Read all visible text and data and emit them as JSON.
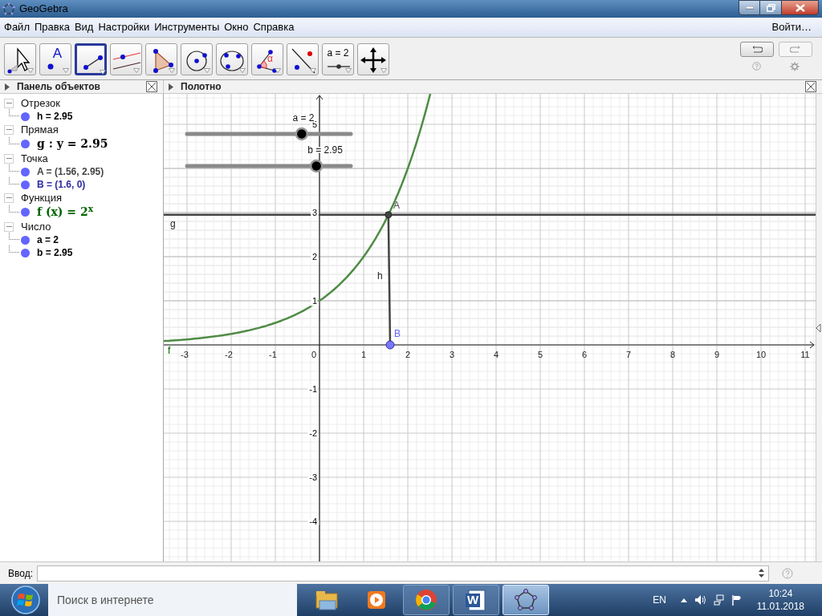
{
  "window": {
    "title": "GeoGebra"
  },
  "menu": [
    "Файл",
    "Правка",
    "Вид",
    "Настройки",
    "Инструменты",
    "Окно",
    "Справка"
  ],
  "login": "Войти…",
  "tools": [
    {
      "selected": false
    },
    {
      "selected": false,
      "label": "A"
    },
    {
      "selected": true
    },
    {
      "selected": false
    },
    {
      "selected": false
    },
    {
      "selected": false
    },
    {
      "selected": false
    },
    {
      "selected": false,
      "label": "α"
    },
    {
      "selected": false
    },
    {
      "selected": false,
      "label": "a = 2"
    },
    {
      "selected": false
    }
  ],
  "algebra_panel": {
    "title": "Панель объектов",
    "groups": [
      {
        "title": "Отрезок",
        "expanded": true,
        "children": [
          {
            "text": "h = 2.95",
            "kind": "plain",
            "color": "#000000"
          }
        ]
      },
      {
        "title": "Прямая",
        "expanded": true,
        "children": [
          {
            "text": "g : y = 2.95",
            "kind": "formula",
            "color": "#000000"
          }
        ]
      },
      {
        "title": "Точка",
        "expanded": true,
        "children": [
          {
            "text": "A = (1.56, 2.95)",
            "kind": "plain",
            "color": "#444444"
          },
          {
            "text": "B = (1.6, 0)",
            "kind": "plain",
            "color": "#2c2ca0"
          }
        ]
      },
      {
        "title": "Функция",
        "expanded": true,
        "children": [
          {
            "text": "f (x) = 2$^{x}$",
            "kind": "formula",
            "color": "#006400"
          }
        ]
      },
      {
        "title": "Число",
        "expanded": true,
        "children": [
          {
            "text": "a = 2",
            "kind": "plain",
            "color": "#000000"
          },
          {
            "text": "b = 2.95",
            "kind": "plain",
            "color": "#000000"
          }
        ]
      }
    ]
  },
  "graphics": {
    "title": "Полотно",
    "x_tick_labels": [
      "-3",
      "-2",
      "-1",
      "1",
      "2",
      "3",
      "4",
      "5",
      "6",
      "7",
      "8",
      "9",
      "10",
      "11"
    ],
    "y_tick_labels": [
      "5",
      "3",
      "2",
      "1",
      "-1",
      "-2",
      "-3",
      "-4"
    ],
    "origin_label": "0",
    "sliders": [
      {
        "label": "a = 2",
        "level": 0.7
      },
      {
        "label": "b = 2.95",
        "level": 0.79
      }
    ],
    "object_labels": [
      {
        "text": "g"
      },
      {
        "text": "h"
      },
      {
        "text": "A"
      },
      {
        "text": "B"
      },
      {
        "text": "f"
      }
    ]
  },
  "input_bar": {
    "label": "Ввод:"
  },
  "taskbar": {
    "search_placeholder": "Поиск в интернете",
    "apps": [
      {
        "kind": "folder",
        "selected": false
      },
      {
        "kind": "media",
        "selected": false
      },
      {
        "kind": "browser",
        "selected": false
      },
      {
        "kind": "word",
        "selected": false,
        "letter": "W"
      },
      {
        "kind": "geogebra",
        "selected": true
      }
    ],
    "language": "EN",
    "time": "10:24",
    "date": "11.01.2018"
  }
}
